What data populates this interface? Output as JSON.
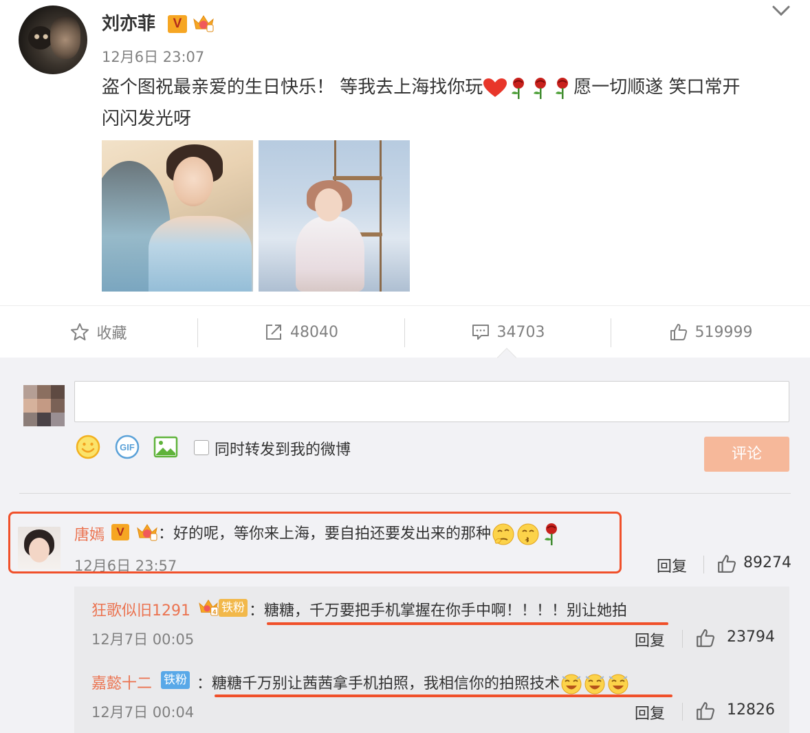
{
  "post": {
    "author": "刘亦菲",
    "verified_badge": "V",
    "time": "12月6日 23:07",
    "text_before_emoji": "盗个图祝最亲爱的生日快乐！ 等我去上海找你玩",
    "text_after_emoji": "愿一切顺遂 笑口常开",
    "text_line2": "闪闪发光呀",
    "emojis": [
      "heart-icon",
      "rose-icon",
      "rose-icon",
      "rose-icon"
    ],
    "photo_count": 2
  },
  "actions": {
    "favorite_label": "收藏",
    "repost_count": "48040",
    "comment_count": "34703",
    "like_count": "519999"
  },
  "composer": {
    "repost_checkbox_label": "同时转发到我的微博",
    "submit_label": "评论",
    "submit_color": "#f6b89a"
  },
  "top_comment": {
    "author": "唐嫣",
    "verified_badge": "V",
    "text": "：好的呢，等你来上海，要自拍还要发出来的那种",
    "time": "12月6日 23:57",
    "reply_label": "回复",
    "likes": "89274"
  },
  "sub_replies": [
    {
      "author": "狂歌似旧1291",
      "badge": "铁粉",
      "badge_level": "4",
      "text": "：糖糖，千万要把手机掌握在你手中啊！！！！别让她拍",
      "time": "12月7日 00:05",
      "reply_label": "回复",
      "likes": "23794"
    },
    {
      "author": "嘉懿十二",
      "badge": "铁粉",
      "text": "：糖糖千万别让茜茜拿手机拍照，我相信你的拍照技术",
      "time": "12月7日 00:04",
      "reply_label": "回复",
      "likes": "12826"
    }
  ],
  "colors": {
    "name_orange": "#eb7350",
    "highlight_red": "#f0502a",
    "badge_gold": "#f6a623",
    "fan_badge_gold": "#f2b84a",
    "fan_badge_blue": "#58a8e8"
  }
}
